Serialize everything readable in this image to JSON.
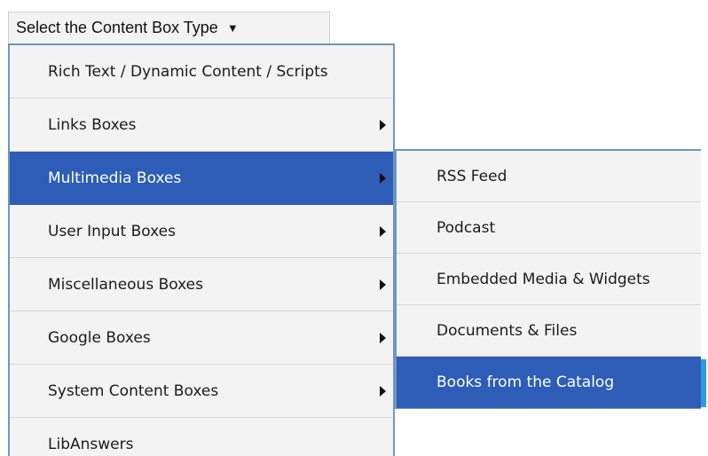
{
  "trigger": {
    "label": "Select the Content Box Type",
    "arrow_icon": "▼"
  },
  "menu": {
    "items": [
      {
        "label": "Rich Text / Dynamic Content / Scripts",
        "has_submenu": false,
        "active": false
      },
      {
        "label": "Links Boxes",
        "has_submenu": true,
        "active": false
      },
      {
        "label": "Multimedia Boxes",
        "has_submenu": true,
        "active": true
      },
      {
        "label": "User Input Boxes",
        "has_submenu": true,
        "active": false
      },
      {
        "label": "Miscellaneous Boxes",
        "has_submenu": true,
        "active": false
      },
      {
        "label": "Google Boxes",
        "has_submenu": true,
        "active": false
      },
      {
        "label": "System Content Boxes",
        "has_submenu": true,
        "active": false
      },
      {
        "label": "LibAnswers",
        "has_submenu": false,
        "active": false
      }
    ]
  },
  "submenu": {
    "items": [
      {
        "label": "RSS Feed",
        "active": false
      },
      {
        "label": "Podcast",
        "active": false
      },
      {
        "label": "Embedded Media & Widgets",
        "active": false
      },
      {
        "label": "Documents & Files",
        "active": false
      },
      {
        "label": "Books from the Catalog",
        "active": true
      }
    ]
  },
  "colors": {
    "highlight": "#2d5db6",
    "menu_border": "#6d97c2",
    "menu_background": "#f3f3f3",
    "selection_bar": "#2f9bde"
  }
}
